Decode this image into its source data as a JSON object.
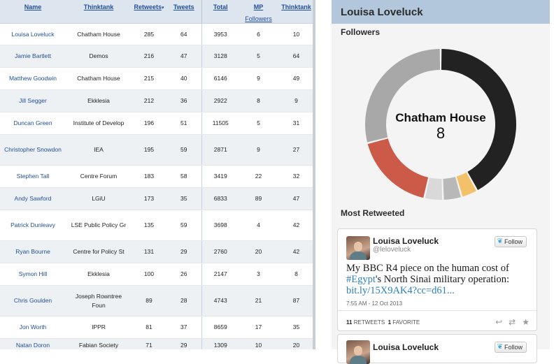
{
  "table": {
    "headers": {
      "name": "Name",
      "thinktank": "Thinktank",
      "retweets": "Retweets",
      "tweets": "Tweets",
      "total": "Total",
      "mp": "MP",
      "followers": "Followers",
      "thinktank2": "Thinktank"
    },
    "rows": [
      {
        "name": "Louisa Loveluck",
        "thinktank": "Chatham House",
        "retweets": "285",
        "tweets": "64",
        "total": "3953",
        "mp": "6",
        "tt": "10"
      },
      {
        "name": "Jamie Bartlett",
        "thinktank": "Demos",
        "retweets": "216",
        "tweets": "47",
        "total": "3128",
        "mp": "5",
        "tt": "64"
      },
      {
        "name": "Matthew Goodwin",
        "thinktank": "Chatham House",
        "retweets": "215",
        "tweets": "40",
        "total": "6146",
        "mp": "9",
        "tt": "49"
      },
      {
        "name": "Jill Segger",
        "thinktank": "Ekklesia",
        "retweets": "212",
        "tweets": "36",
        "total": "2922",
        "mp": "8",
        "tt": "9"
      },
      {
        "name": "Duncan Green",
        "thinktank": "Institute of Develop",
        "retweets": "196",
        "tweets": "51",
        "total": "11505",
        "mp": "5",
        "tt": "31"
      },
      {
        "name": "Christopher Snowdon",
        "thinktank": "IEA",
        "retweets": "195",
        "tweets": "59",
        "total": "2871",
        "mp": "9",
        "tt": "27"
      },
      {
        "name": "Stephen Tall",
        "thinktank": "Centre Forum",
        "retweets": "183",
        "tweets": "58",
        "total": "3419",
        "mp": "22",
        "tt": "32"
      },
      {
        "name": "Andy Sawford",
        "thinktank": "LGiU",
        "retweets": "173",
        "tweets": "35",
        "total": "6833",
        "mp": "89",
        "tt": "47"
      },
      {
        "name": "Patrick Dunleavy",
        "thinktank": "LSE Public Policy Gr",
        "retweets": "135",
        "tweets": "59",
        "total": "3698",
        "mp": "4",
        "tt": "42"
      },
      {
        "name": "Ryan Bourne",
        "thinktank": "Centre for Policy St",
        "retweets": "131",
        "tweets": "29",
        "total": "2760",
        "mp": "20",
        "tt": "42"
      },
      {
        "name": "Symon Hill",
        "thinktank": "Ekklesia",
        "retweets": "100",
        "tweets": "26",
        "total": "2147",
        "mp": "3",
        "tt": "8"
      },
      {
        "name": "Chris Goulden",
        "thinktank": "Joseph Rowntree Foun",
        "retweets": "89",
        "tweets": "28",
        "total": "4743",
        "mp": "21",
        "tt": "87"
      },
      {
        "name": "Jon Worth",
        "thinktank": "IPPR",
        "retweets": "81",
        "tweets": "37",
        "total": "8659",
        "mp": "17",
        "tt": "35"
      },
      {
        "name": "Natan Doron",
        "thinktank": "Fabian Society",
        "retweets": "71",
        "tweets": "29",
        "total": "1309",
        "mp": "10",
        "tt": "20"
      }
    ]
  },
  "profile": {
    "name": "Louisa Loveluck",
    "followers_title": "Followers",
    "most_retweeted_title": "Most Retweeted",
    "donut": {
      "center_label": "Chatham House",
      "center_value": "8",
      "colors": {
        "dark": "#222222",
        "yellow": "#f3c16a",
        "mid_gray": "#b8b8b8",
        "light_gray": "#d9d9d9",
        "red": "#cc5a48",
        "gray": "#a8a8a8"
      },
      "segments": [
        {
          "value": 42,
          "color": "#222222"
        },
        {
          "value": 3.5,
          "color": "#f3c16a"
        },
        {
          "value": 4,
          "color": "#b8b8b8"
        },
        {
          "value": 4,
          "color": "#d9d9d9"
        },
        {
          "value": 17.5,
          "color": "#cc5a48"
        },
        {
          "value": 29,
          "color": "#a8a8a8"
        }
      ]
    },
    "tweets": [
      {
        "name": "Louisa Loveluck",
        "handle": "@leloveluck",
        "follow_label": "Follow",
        "text_pre": "My BBC R4 piece on the human cost of ",
        "hashtag": "#Egypt",
        "text_post": "'s North Sinai military operation: ",
        "link": "bit.ly/15X9AK4?cc=d61...",
        "time": "7:55 AM - 12 Oct 2013",
        "retweets_count": "11",
        "retweets_label": "RETWEETS",
        "favorites_count": "1",
        "favorites_label": "FAVORITE"
      },
      {
        "name": "Louisa Loveluck",
        "follow_label": "Follow"
      }
    ]
  }
}
